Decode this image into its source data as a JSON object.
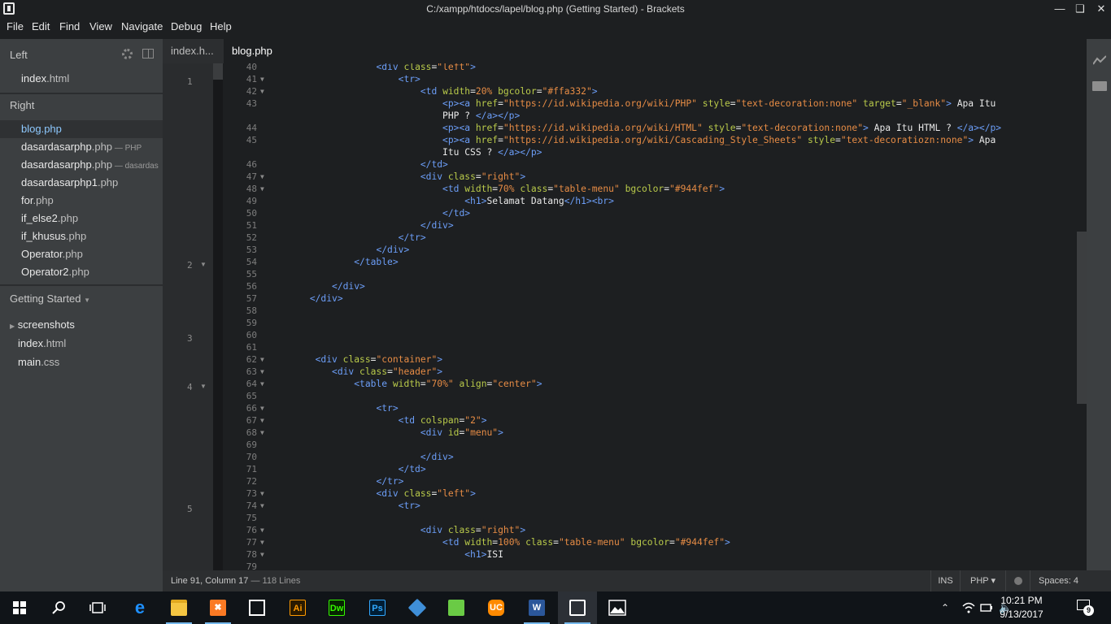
{
  "window": {
    "title": "C:/xampp/htdocs/lapel/blog.php (Getting Started) - Brackets",
    "controls": [
      "—",
      "❑",
      "✕"
    ]
  },
  "menu": [
    "File",
    "Edit",
    "Find",
    "View",
    "Navigate",
    "Debug",
    "Help"
  ],
  "sidebar": {
    "left_title": "Left",
    "left_files": [
      {
        "name": "index",
        "ext": ".html"
      }
    ],
    "right_title": "Right",
    "right_files": [
      {
        "name": "blog",
        "ext": ".php",
        "dir": ""
      },
      {
        "name": "dasardasarphp",
        "ext": ".php",
        "dir": " — PHP"
      },
      {
        "name": "dasardasarphp",
        "ext": ".php",
        "dir": " — dasardas"
      },
      {
        "name": "dasardasarphp1",
        "ext": ".php",
        "dir": ""
      },
      {
        "name": "for",
        "ext": ".php",
        "dir": ""
      },
      {
        "name": "if_else2",
        "ext": ".php",
        "dir": ""
      },
      {
        "name": "if_khusus",
        "ext": ".php",
        "dir": ""
      },
      {
        "name": "Operator",
        "ext": ".php",
        "dir": ""
      },
      {
        "name": "Operator2",
        "ext": ".php",
        "dir": ""
      }
    ],
    "project_title": "Getting Started",
    "project_tree": [
      {
        "name": "screenshots",
        "ext": "",
        "folder": true
      },
      {
        "name": "index",
        "ext": ".html",
        "folder": false
      },
      {
        "name": "main",
        "ext": ".css",
        "folder": false
      }
    ]
  },
  "tabs": [
    {
      "label": "index.h...",
      "active": false
    },
    {
      "label": "blog.php",
      "active": true
    }
  ],
  "fold_gutter": [
    {
      "num": "1",
      "arrow": ""
    },
    {
      "num": "2",
      "arrow": "▼"
    },
    {
      "num": "3",
      "arrow": ""
    },
    {
      "num": "4",
      "arrow": "▼"
    },
    {
      "num": "5",
      "arrow": ""
    }
  ],
  "code_lines": [
    {
      "ln": "40",
      "fold": "",
      "html": "                  <span class='t'>&lt;div</span> <span class='a'>class</span>=<span class='s'>\"left\"</span><span class='t'>&gt;</span>"
    },
    {
      "ln": "41",
      "fold": "▼",
      "html": "                      <span class='t'>&lt;tr&gt;</span>"
    },
    {
      "ln": "42",
      "fold": "▼",
      "html": "                          <span class='t'>&lt;td</span> <span class='a'>width</span>=<span class='s'>20%</span> <span class='a'>bgcolor</span>=<span class='s'>\"#ffa332\"</span><span class='t'>&gt;</span>"
    },
    {
      "ln": "43",
      "fold": "",
      "html": "                              <span class='t'>&lt;p&gt;&lt;a</span> <span class='a'>href</span>=<span class='s'>\"https://id.wikipedia.org/wiki/PHP\"</span> <span class='a'>style</span>=<span class='s'>\"text-decoration:none\"</span> <span class='a'>target</span>=<span class='s'>\"_blank\"</span><span class='t'>&gt;</span> Apa Itu"
    },
    {
      "ln": "",
      "fold": "",
      "html": "                              PHP ? <span class='t'>&lt;/a&gt;&lt;/p&gt;</span>"
    },
    {
      "ln": "44",
      "fold": "",
      "html": "                              <span class='t'>&lt;p&gt;&lt;a</span> <span class='a'>href</span>=<span class='s'>\"https://id.wikipedia.org/wiki/HTML\"</span> <span class='a'>style</span>=<span class='s'>\"text-decoration:none\"</span><span class='t'>&gt;</span> Apa Itu HTML ? <span class='t'>&lt;/a&gt;&lt;/p&gt;</span>"
    },
    {
      "ln": "45",
      "fold": "",
      "html": "                              <span class='t'>&lt;p&gt;&lt;a</span> <span class='a'>href</span>=<span class='s'>\"https://id.wikipedia.org/wiki/Cascading_Style_Sheets\"</span> <span class='a'>style</span>=<span class='s'>\"text-decoratiozn:none\"</span><span class='t'>&gt;</span> Apa"
    },
    {
      "ln": "",
      "fold": "",
      "html": "                              Itu CSS ? <span class='t'>&lt;/a&gt;&lt;/p&gt;</span>"
    },
    {
      "ln": "46",
      "fold": "",
      "html": "                          <span class='t'>&lt;/td&gt;</span>"
    },
    {
      "ln": "47",
      "fold": "▼",
      "html": "                          <span class='t'>&lt;div</span> <span class='a'>class</span>=<span class='s'>\"right\"</span><span class='t'>&gt;</span>"
    },
    {
      "ln": "48",
      "fold": "▼",
      "html": "                              <span class='t'>&lt;td</span> <span class='a'>width</span>=<span class='s'>70%</span> <span class='a'>class</span>=<span class='s'>\"table-menu\"</span> <span class='a'>bgcolor</span>=<span class='s'>\"#944fef\"</span><span class='t'>&gt;</span>"
    },
    {
      "ln": "49",
      "fold": "",
      "html": "                                  <span class='t'>&lt;h1&gt;</span>Selamat Datang<span class='t'>&lt;/h1&gt;&lt;br&gt;</span>"
    },
    {
      "ln": "50",
      "fold": "",
      "html": "                              <span class='t'>&lt;/td&gt;</span>"
    },
    {
      "ln": "51",
      "fold": "",
      "html": "                          <span class='t'>&lt;/div&gt;</span>"
    },
    {
      "ln": "52",
      "fold": "",
      "html": "                      <span class='t'>&lt;/tr&gt;</span>"
    },
    {
      "ln": "53",
      "fold": "",
      "html": "                  <span class='t'>&lt;/div&gt;</span>"
    },
    {
      "ln": "54",
      "fold": "",
      "html": "              <span class='t'>&lt;/table&gt;</span>"
    },
    {
      "ln": "55",
      "fold": "",
      "html": ""
    },
    {
      "ln": "56",
      "fold": "",
      "html": "          <span class='t'>&lt;/div&gt;</span>"
    },
    {
      "ln": "57",
      "fold": "",
      "html": "      <span class='t'>&lt;/div&gt;</span>"
    },
    {
      "ln": "58",
      "fold": "",
      "html": ""
    },
    {
      "ln": "59",
      "fold": "",
      "html": ""
    },
    {
      "ln": "60",
      "fold": "",
      "html": ""
    },
    {
      "ln": "61",
      "fold": "",
      "html": ""
    },
    {
      "ln": "62",
      "fold": "▼",
      "html": "       <span class='t'>&lt;div</span> <span class='a'>class</span>=<span class='s'>\"container\"</span><span class='t'>&gt;</span>"
    },
    {
      "ln": "63",
      "fold": "▼",
      "html": "          <span class='t'>&lt;div</span> <span class='a'>class</span>=<span class='s'>\"header\"</span><span class='t'>&gt;</span>"
    },
    {
      "ln": "64",
      "fold": "▼",
      "html": "              <span class='t'>&lt;table</span> <span class='a'>width</span>=<span class='s'>\"70%\"</span> <span class='a'>align</span>=<span class='s'>\"center\"</span><span class='t'>&gt;</span>"
    },
    {
      "ln": "65",
      "fold": "",
      "html": ""
    },
    {
      "ln": "66",
      "fold": "▼",
      "html": "                  <span class='t'>&lt;tr&gt;</span>"
    },
    {
      "ln": "67",
      "fold": "▼",
      "html": "                      <span class='t'>&lt;td</span> <span class='a'>colspan</span>=<span class='s'>\"2\"</span><span class='t'>&gt;</span>"
    },
    {
      "ln": "68",
      "fold": "▼",
      "html": "                          <span class='t'>&lt;div</span> <span class='a'>id</span>=<span class='s'>\"menu\"</span><span class='t'>&gt;</span>"
    },
    {
      "ln": "69",
      "fold": "",
      "html": ""
    },
    {
      "ln": "70",
      "fold": "",
      "html": "                          <span class='t'>&lt;/div&gt;</span>"
    },
    {
      "ln": "71",
      "fold": "",
      "html": "                      <span class='t'>&lt;/td&gt;</span>"
    },
    {
      "ln": "72",
      "fold": "",
      "html": "                  <span class='t'>&lt;/tr&gt;</span>"
    },
    {
      "ln": "73",
      "fold": "▼",
      "html": "                  <span class='t'>&lt;div</span> <span class='a'>class</span>=<span class='s'>\"left\"</span><span class='t'>&gt;</span>"
    },
    {
      "ln": "74",
      "fold": "▼",
      "html": "                      <span class='t'>&lt;tr&gt;</span>"
    },
    {
      "ln": "75",
      "fold": "",
      "html": ""
    },
    {
      "ln": "76",
      "fold": "▼",
      "html": "                          <span class='t'>&lt;div</span> <span class='a'>class</span>=<span class='s'>\"right\"</span><span class='t'>&gt;</span>"
    },
    {
      "ln": "77",
      "fold": "▼",
      "html": "                              <span class='t'>&lt;td</span> <span class='a'>width</span>=<span class='s'>100%</span> <span class='a'>class</span>=<span class='s'>\"table-menu\"</span> <span class='a'>bgcolor</span>=<span class='s'>\"#944fef\"</span><span class='t'>&gt;</span>"
    },
    {
      "ln": "78",
      "fold": "▼",
      "html": "                                  <span class='t'>&lt;h1&gt;</span>ISI"
    },
    {
      "ln": "79",
      "fold": "",
      "html": ""
    }
  ],
  "status": {
    "cursor": "Line 91, Column 17",
    "lines": " — 118 Lines",
    "ins": "INS",
    "language": "PHP ▾",
    "spaces": "Spaces: 4"
  },
  "taskbar": {
    "apps": [
      {
        "name": "start-button",
        "label": "",
        "color": "#ffffff"
      },
      {
        "name": "search-icon",
        "label": "",
        "color": "#ffffff"
      },
      {
        "name": "task-view-icon",
        "label": "",
        "color": "#ffffff"
      },
      {
        "name": "edge-icon",
        "label": "e",
        "color": "#1e90ff"
      },
      {
        "name": "file-explorer-icon",
        "label": "",
        "color": "#f4c542"
      },
      {
        "name": "xampp-icon",
        "label": "✖",
        "color": "#fb7a24"
      },
      {
        "name": "store-icon",
        "label": "",
        "color": "#ffffff"
      },
      {
        "name": "illustrator-icon",
        "label": "Ai",
        "color": "#ff9a00"
      },
      {
        "name": "dreamweaver-icon",
        "label": "Dw",
        "color": "#35fa00"
      },
      {
        "name": "photoshop-icon",
        "label": "Ps",
        "color": "#31a8ff"
      },
      {
        "name": "virtualbox-icon",
        "label": "",
        "color": "#3f8fd8"
      },
      {
        "name": "sketchup-icon",
        "label": "",
        "color": "#6acb45"
      },
      {
        "name": "uc-browser-icon",
        "label": "UC",
        "color": "#ff8a00"
      },
      {
        "name": "word-icon",
        "label": "W",
        "color": "#2b579a"
      },
      {
        "name": "brackets-icon",
        "label": "",
        "color": "#ffffff"
      },
      {
        "name": "photos-icon",
        "label": "",
        "color": "#ffffff"
      }
    ],
    "time": "10:21 PM",
    "date": "9/13/2017",
    "notifications": "9"
  }
}
